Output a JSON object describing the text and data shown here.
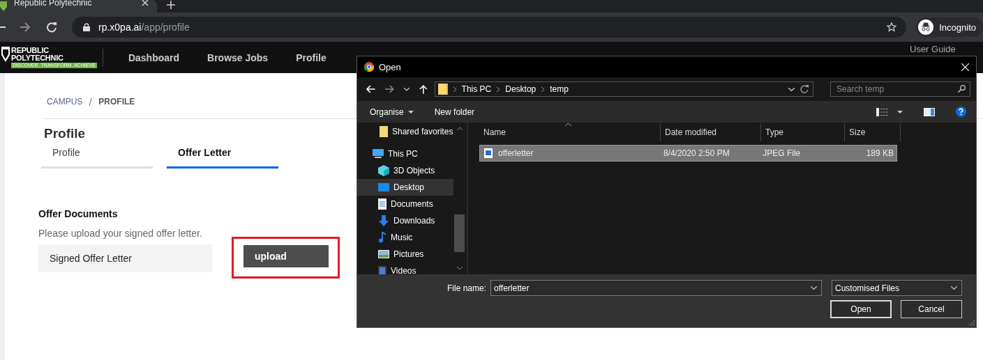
{
  "browser": {
    "tab_title": "Republic Polytechnic",
    "url_host": "rp.x0pa.ai",
    "url_path": "/app/profile",
    "profile_label": "Incognito"
  },
  "logo": {
    "lines": [
      "REPUBLIC",
      "POLYTECHNIC"
    ],
    "tagline": "DISCOVER. TRANSFORM. ACHIEVE"
  },
  "nav": {
    "items": [
      "Dashboard",
      "Browse Jobs",
      "Profile"
    ],
    "user_guide": "User Guide"
  },
  "breadcrumb": [
    {
      "label": "CAMPUS",
      "current": false
    },
    {
      "label": "PROFILE",
      "current": true
    }
  ],
  "page_title": "Profile",
  "tabs": [
    {
      "label": "Profile",
      "selected": false
    },
    {
      "label": "Offer Letter",
      "selected": true
    }
  ],
  "offer": {
    "heading": "Offer Documents",
    "hint": "Please upload your signed offer letter.",
    "document_label": "Signed Offer Letter",
    "upload_button": "upload",
    "highlighted": true
  },
  "dialog": {
    "title": "Open",
    "path": [
      "This PC",
      "Desktop",
      "temp"
    ],
    "search_placeholder": "Search temp",
    "organise": "Organise",
    "new_folder": "New folder",
    "nav_items": [
      {
        "label": "Shared favorites",
        "kind": "folder",
        "selected": false
      },
      {
        "label": "This PC",
        "kind": "pc",
        "selected": false,
        "children": [
          {
            "label": "3D Objects",
            "kind": "cube",
            "selected": false
          },
          {
            "label": "Desktop",
            "kind": "desktop",
            "selected": true
          },
          {
            "label": "Documents",
            "kind": "document",
            "selected": false
          },
          {
            "label": "Downloads",
            "kind": "download",
            "selected": false
          },
          {
            "label": "Music",
            "kind": "music",
            "selected": false
          },
          {
            "label": "Pictures",
            "kind": "picture",
            "selected": false
          },
          {
            "label": "Videos",
            "kind": "video",
            "selected": false
          }
        ]
      }
    ],
    "columns": [
      "Name",
      "Date modified",
      "Type",
      "Size"
    ],
    "files": [
      {
        "name": "offerletter",
        "date": "8/4/2020 2:50 PM",
        "type": "JPEG File",
        "size": "189 KB",
        "selected": true
      }
    ],
    "file_name_label": "File name:",
    "file_name": "offerletter",
    "filter": "Customised Files",
    "buttons": [
      "Open",
      "Cancel"
    ]
  }
}
